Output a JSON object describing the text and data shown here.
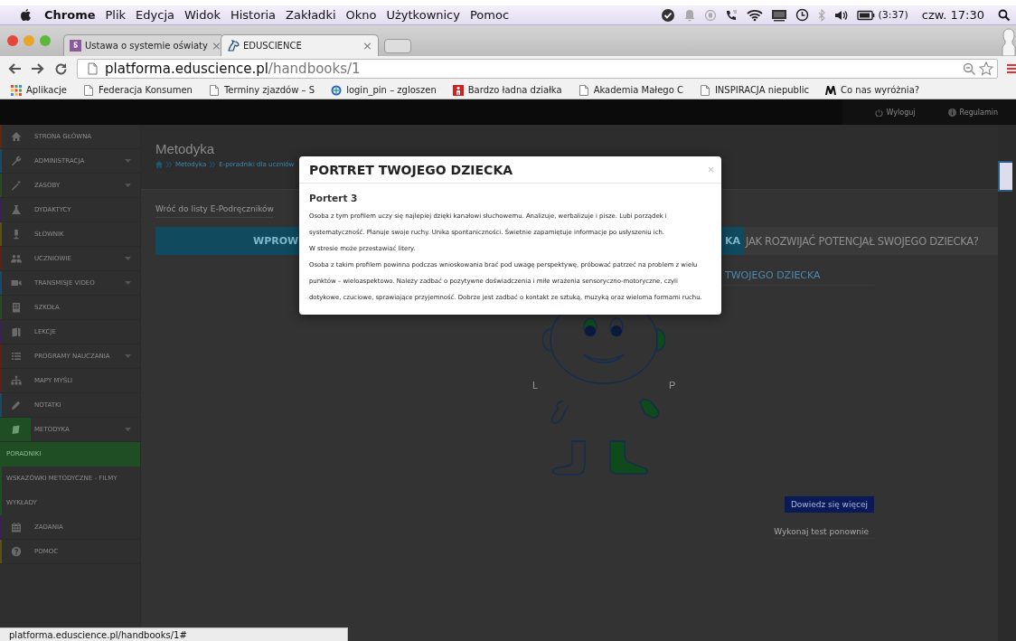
{
  "menubar": {
    "app": "Chrome",
    "menus": [
      "Plik",
      "Edycja",
      "Widok",
      "Historia",
      "Zakładki",
      "Okno",
      "Użytkownicy",
      "Pomoc"
    ],
    "battery_time": "(3:37)",
    "clock": "czw. 17:30"
  },
  "browser": {
    "tabs": [
      {
        "title": "Ustawa o systemie oświaty",
        "close": "×",
        "selected": false
      },
      {
        "title": "EDUSCIENCE",
        "close": "×",
        "selected": true
      }
    ],
    "address": {
      "host": "platforma.eduscience.pl",
      "path": "/handbooks/1"
    },
    "bookmarks": [
      "Aplikacje",
      "Federacja Konsumen",
      "Terminy zjazdów – S",
      "login_pin – zgloszen",
      "Bardzo ładna działka",
      "Akademia Małego C",
      "INSPIRACJA niepublic",
      "Co nas wyróżnia?"
    ]
  },
  "top_bar": {
    "links": [
      "Wyloguj",
      "Regulamin"
    ]
  },
  "sidebar": {
    "items": [
      {
        "label": "STRONA GŁÓWNA",
        "color": "#5a2a12",
        "expandable": false,
        "selected": false
      },
      {
        "label": "ADMINISTRACJA",
        "color": "#1c4a66",
        "expandable": true,
        "selected": false
      },
      {
        "label": "ZASOBY",
        "color": "#2c4a22",
        "expandable": true,
        "selected": false
      },
      {
        "label": "DYDAKTYCY",
        "color": "#3a2252",
        "expandable": false,
        "selected": false
      },
      {
        "label": "SŁOWNIK",
        "color": "#5a5214",
        "expandable": false,
        "selected": false
      },
      {
        "label": "UCZNIOWIE",
        "color": "#5a2414",
        "expandable": true,
        "selected": false
      },
      {
        "label": "TRANSMISJE VIDEO",
        "color": "#1c4a66",
        "expandable": true,
        "selected": false
      },
      {
        "label": "SZKOŁA",
        "color": "#2c4a22",
        "expandable": false,
        "selected": false
      },
      {
        "label": "LEKCJE",
        "color": "#3a2252",
        "expandable": false,
        "selected": false
      },
      {
        "label": "PROGRAMY NAUCZANIA",
        "color": "#5a2414",
        "expandable": true,
        "selected": false
      },
      {
        "label": "MAPY MYŚLI",
        "color": "#5a2414",
        "expandable": false,
        "selected": false
      },
      {
        "label": "NOTATKI",
        "color": "#1c4a66",
        "expandable": false,
        "selected": false
      },
      {
        "label": "METODYKA",
        "color": "#1f4d24",
        "expandable": true,
        "selected": true,
        "children": [
          {
            "label": "PORADNIKI",
            "selected": true
          },
          {
            "label": "WSKAZÓWKI METODYCZNE - FILMY",
            "selected": false
          },
          {
            "label": "WYKŁADY",
            "selected": false
          }
        ]
      },
      {
        "label": "ZADANIA",
        "color": "#3a2252",
        "expandable": false,
        "selected": false
      },
      {
        "label": "POMOC",
        "color": "#5a5214",
        "expandable": false,
        "selected": false
      }
    ]
  },
  "page": {
    "title": "Metodyka",
    "breadcrumb": [
      "Metodyka",
      "E-poradniki dla uczniów"
    ],
    "back_button": "Wróć do listy E-Podręczników",
    "tabs": [
      {
        "label_parts": [
          "WPROW",
          "KA"
        ],
        "selected": true
      },
      {
        "label_parts": [
          "JAK ROZWIJAĆ POTENCJAŁ SWOJEGO DZIECKA?"
        ],
        "selected": false
      }
    ],
    "section_heading": "TWOJEGO DZIECKA",
    "figure_labels": [
      "L",
      "P"
    ],
    "more_button": "Dowiedz się więcej",
    "retake_link": "Wykonaj test ponownie"
  },
  "modal": {
    "title": "PORTRET TWOJEGO DZIECKA",
    "close": "×",
    "subtitle": "Portert 3",
    "paragraphs": [
      "Osoba z tym profilem uczy się najlepiej dzięki kanałowi słuchowemu. Analizuje, werbalizuje i pisze. Lubi porządek i systematyczność. Planuje swoje ruchy. Unika spontaniczności. Świetnie zapamiętuje informacje po usłyszeniu ich.",
      "W stresie może przestawiać litery.",
      "Osoba z takim profilem powinna podczas wnioskowania brać pod uwagę perspektywę, próbować patrzeć na problem z wielu punktów – wieloaspektowo. Należy zadbać o pozytywne doświadczenia i miłe wrażenia sensoryczno-motoryczne, czyli dotykowe, czuciowe, sprawiające przyjemność. Dobrze jest zadbać o kontakt ze sztuką, muzyką oraz wieloma formami ruchu."
    ]
  },
  "status_bar": "platforma.eduscience.pl/handbooks/1#"
}
